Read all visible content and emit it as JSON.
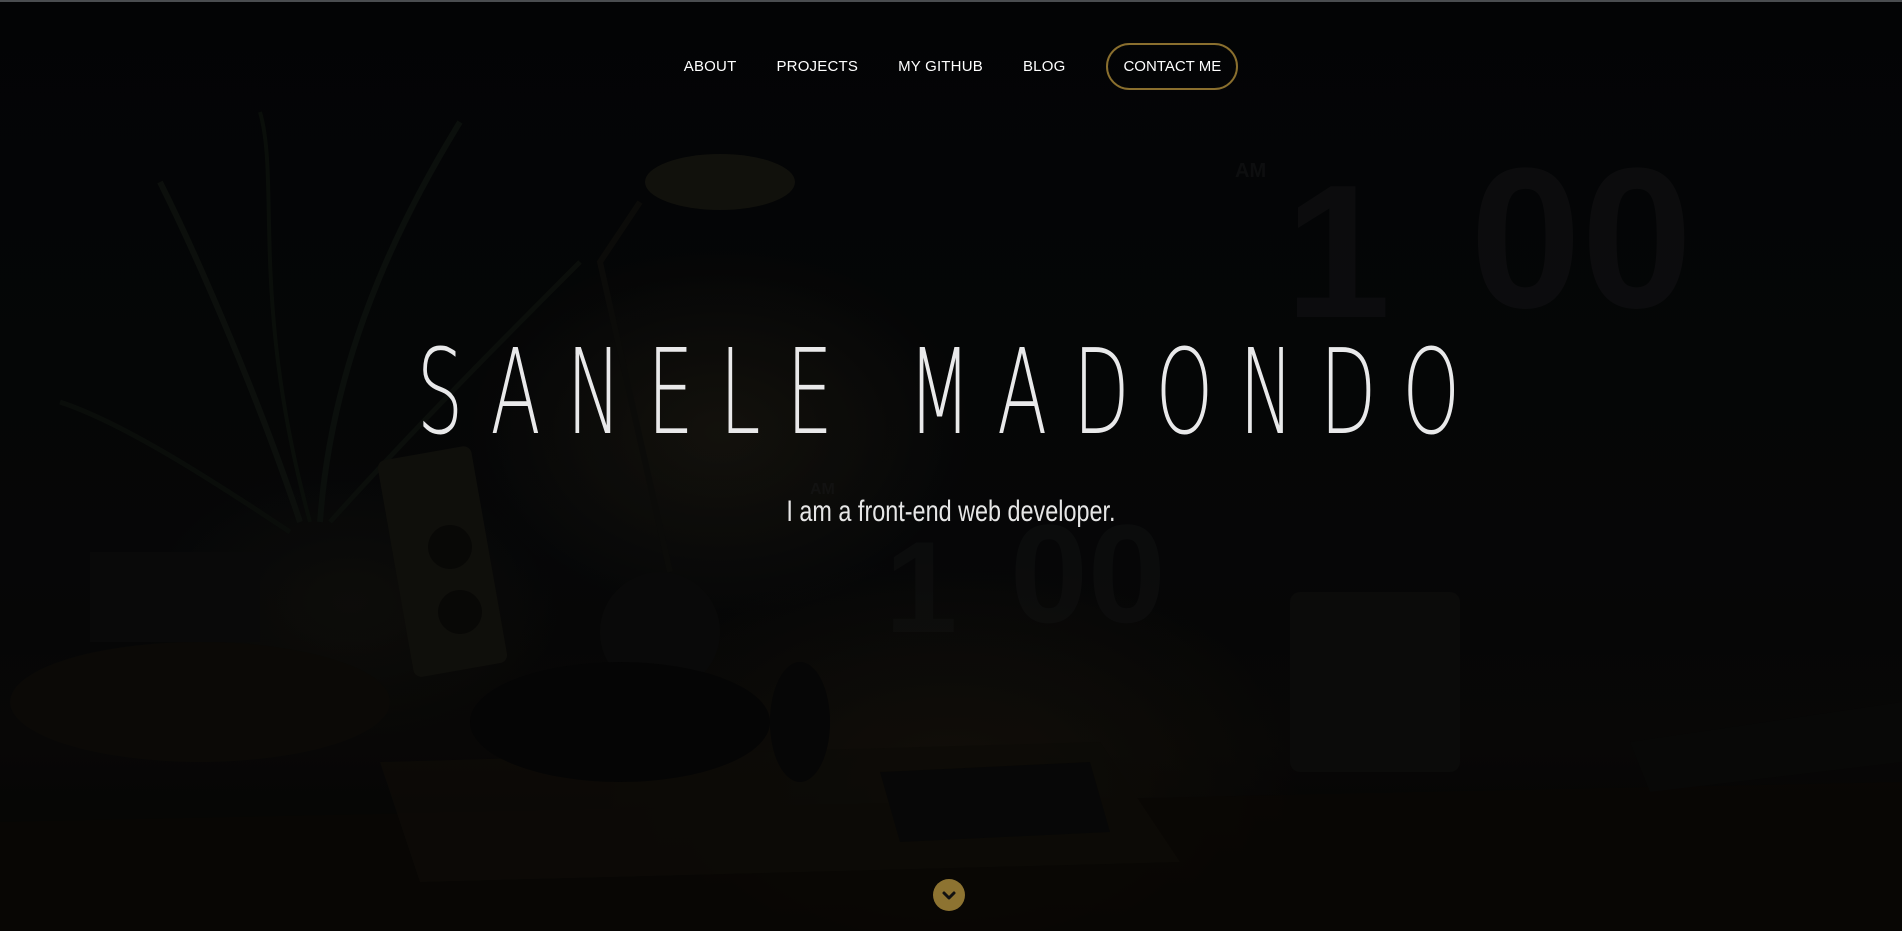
{
  "nav": {
    "items": [
      {
        "label": "ABOUT"
      },
      {
        "label": "PROJECTS"
      },
      {
        "label": "MY GITHUB"
      },
      {
        "label": "BLOG"
      }
    ],
    "contact_label": "CONTACT ME"
  },
  "hero": {
    "title": "SANELE MADONDO",
    "subtitle": "I am a front-end web developer.",
    "clock_large": {
      "period": "AM",
      "hour": "1",
      "minutes": "00"
    },
    "clock_small": {
      "period": "AM",
      "hour": "1",
      "minutes": "00"
    }
  },
  "scroll_icon": "chevron-down-icon",
  "colors": {
    "accent": "#8d7331",
    "button_border": "#8a6f2e",
    "text": "#ffffff",
    "background": "#030405"
  }
}
